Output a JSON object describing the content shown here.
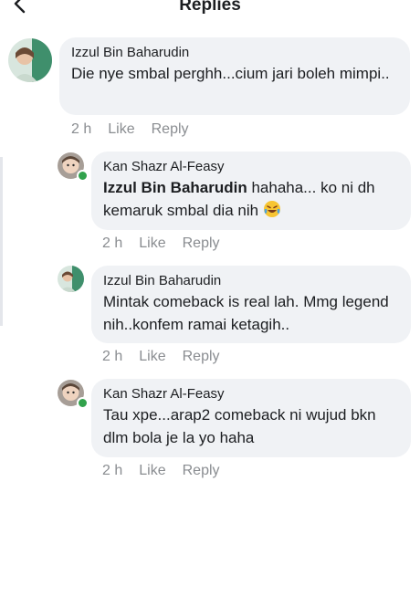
{
  "header": {
    "title": "Replies",
    "back_icon": "chevron-left-icon"
  },
  "colors": {
    "bubble": "#f0f2f5",
    "meta": "#8a8d91",
    "online": "#31a24c"
  },
  "comments": [
    {
      "author": "Izzul Bin Baharudin",
      "text": "Die nye smbal perghh...cium jari boleh mimpi..",
      "time": "2 h",
      "like": "Like",
      "reply": "Reply"
    },
    {
      "author": "Kan Shazr Al-Feasy",
      "mention": "Izzul Bin Baharudin",
      "text": " hahaha... ko ni dh kemaruk smbal dia nih",
      "emoji": "laughing-tears-emoji",
      "time": "2 h",
      "like": "Like",
      "reply": "Reply"
    },
    {
      "author": "Izzul Bin Baharudin",
      "text": "Mintak comeback is real lah. Mmg legend nih..konfem ramai ketagih..",
      "time": "2 h",
      "like": "Like",
      "reply": "Reply"
    },
    {
      "author": "Kan Shazr Al-Feasy",
      "text": "Tau xpe...arap2 comeback ni wujud bkn dlm bola je la yo haha",
      "time": "2 h",
      "like": "Like",
      "reply": "Reply"
    }
  ]
}
